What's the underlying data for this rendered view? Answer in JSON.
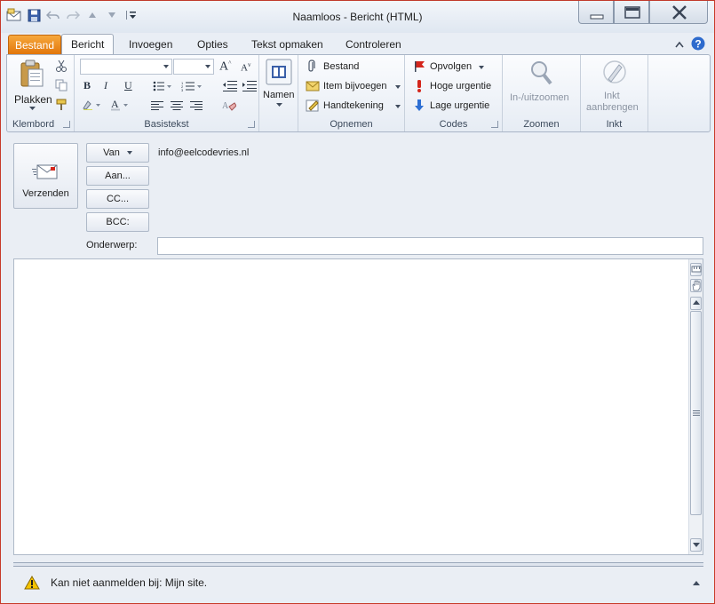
{
  "window": {
    "title": "Naamloos  -  Bericht (HTML)"
  },
  "tabs": {
    "file": "Bestand",
    "items": [
      "Bericht",
      "Invoegen",
      "Opties",
      "Tekst opmaken",
      "Controleren"
    ]
  },
  "ribbon": {
    "clipboard": {
      "label": "Klembord",
      "paste": "Plakken"
    },
    "basic_text": {
      "label": "Basistekst",
      "font_name": "",
      "font_size": ""
    },
    "names": {
      "label": "Namen"
    },
    "include": {
      "label": "Opnemen",
      "file": "Bestand",
      "insert_item": "Item bijvoegen",
      "signature": "Handtekening"
    },
    "tags": {
      "label": "Codes",
      "follow_up": "Opvolgen",
      "high_priority": "Hoge urgentie",
      "low_priority": "Lage urgentie"
    },
    "zoom": {
      "label": "Zoomen",
      "zoom_button": "In-/uitzoomen"
    },
    "ink": {
      "label": "Inkt",
      "apply_line1": "Inkt",
      "apply_line2": "aanbrengen"
    }
  },
  "compose": {
    "send": "Verzenden",
    "from_button": "Van",
    "from_value": "info@eelcodevries.nl",
    "to_button": "Aan...",
    "cc_button": "CC...",
    "bcc_button": "BCC:",
    "subject_label": "Onderwerp:",
    "subject_value": "",
    "body": ""
  },
  "infobar": {
    "message": "Kan niet aanmelden bij: Mijn site."
  },
  "colors": {
    "file_tab": "#e2760b",
    "warning": "#f5c400",
    "flag": "#d4261c",
    "low_priority": "#2d6fd3"
  }
}
